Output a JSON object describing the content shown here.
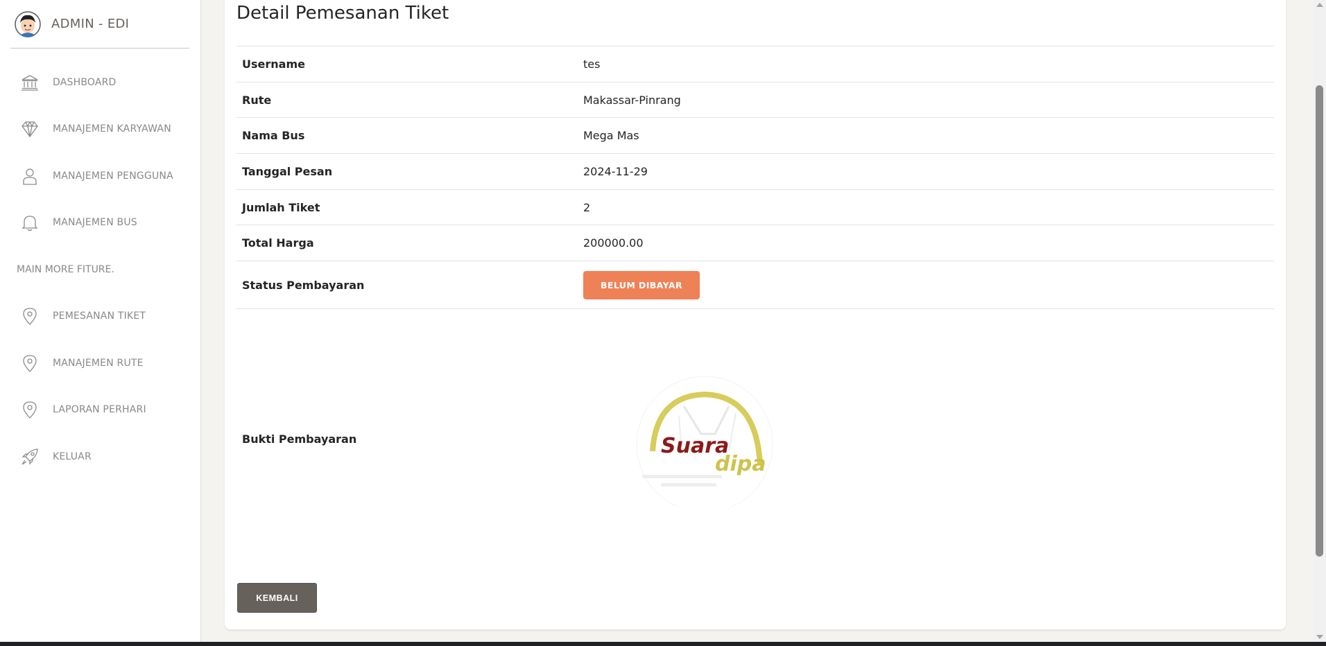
{
  "sidebar": {
    "brand": "ADMIN - EDI",
    "items": [
      {
        "label": "DASHBOARD",
        "icon": "bank-icon"
      },
      {
        "label": "MANAJEMEN KARYAWAN",
        "icon": "diamond-icon"
      },
      {
        "label": "MANAJEMEN PENGGUNA",
        "icon": "user-icon"
      },
      {
        "label": "MANAJEMEN BUS",
        "icon": "bell-icon"
      }
    ],
    "section_label": "MAIN MORE FITURE.",
    "more_items": [
      {
        "label": "PEMESANAN TIKET",
        "icon": "pin-icon"
      },
      {
        "label": "MANAJEMEN RUTE",
        "icon": "pin-icon"
      },
      {
        "label": "LAPORAN PERHARI",
        "icon": "pin-icon"
      },
      {
        "label": "KELUAR",
        "icon": "rocket-icon"
      }
    ]
  },
  "main": {
    "title": "Detail Pemesanan Tiket",
    "fields": [
      {
        "label": "Username",
        "value": "tes"
      },
      {
        "label": "Rute",
        "value": "Makassar-Pinrang"
      },
      {
        "label": "Nama Bus",
        "value": "Mega Mas"
      },
      {
        "label": "Tanggal Pesan",
        "value": "2024-11-29"
      },
      {
        "label": "Jumlah Tiket",
        "value": "2"
      },
      {
        "label": "Total Harga",
        "value": "200000.00"
      }
    ],
    "status": {
      "label": "Status Pembayaran",
      "value": "BELUM DIBAYAR"
    },
    "proof": {
      "label": "Bukti Pembayaran",
      "logo_text_1": "Suara",
      "logo_text_2": "dipa"
    },
    "back_label": "KEMBALI"
  },
  "colors": {
    "status_warning": "#ef8157",
    "back_button": "#66615b",
    "page_bg": "#f4f3ef"
  }
}
